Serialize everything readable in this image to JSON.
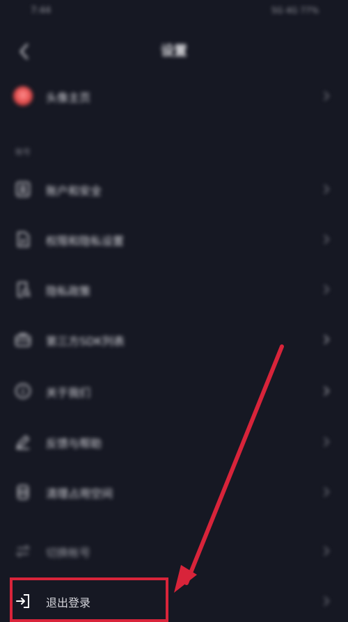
{
  "status_bar": {
    "time": "7:44",
    "right": "5G 4G 77%"
  },
  "header": {
    "title": "设置"
  },
  "profile": {
    "label": "头像主页"
  },
  "section": {
    "label": "账号"
  },
  "menu": [
    {
      "label": "账户和安全",
      "icon": "id-card-icon"
    },
    {
      "label": "权限和隐私设置",
      "icon": "document-icon"
    },
    {
      "label": "隐私政策",
      "icon": "privacy-search-icon"
    },
    {
      "label": "第三方SDK列表",
      "icon": "briefcase-icon"
    },
    {
      "label": "关于我们",
      "icon": "info-circle-icon"
    },
    {
      "label": "反馈与帮助",
      "icon": "feedback-pen-icon"
    },
    {
      "label": "清理占用空间",
      "icon": "storage-icon"
    }
  ],
  "switch_account": {
    "label": "切换帐号",
    "icon": "switch-arrows-icon"
  },
  "logout": {
    "label": "退出登录",
    "icon": "logout-icon"
  },
  "colors": {
    "background": "#161823",
    "highlight": "#d8243a"
  }
}
